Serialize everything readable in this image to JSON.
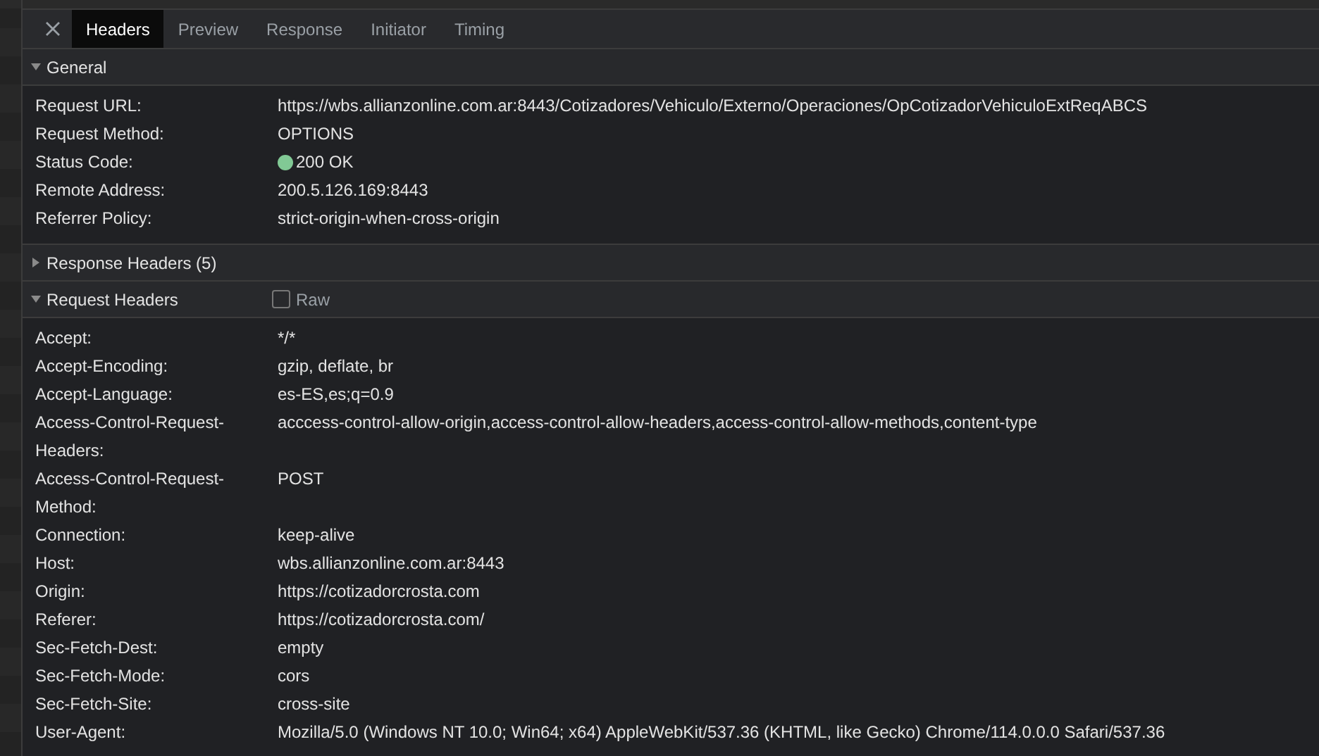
{
  "tabs": [
    {
      "label": "Headers",
      "selected": true
    },
    {
      "label": "Preview",
      "selected": false
    },
    {
      "label": "Response",
      "selected": false
    },
    {
      "label": "Initiator",
      "selected": false
    },
    {
      "label": "Timing",
      "selected": false
    }
  ],
  "sections": [
    {
      "title": "General",
      "expanded": true,
      "rows": [
        {
          "kind": "text",
          "name": "Request URL:",
          "value": "https://wbs.allianzonline.com.ar:8443/Cotizadores/Vehiculo/Externo/Operaciones/OpCotizadorVehiculoExtReqABCS"
        },
        {
          "kind": "text",
          "name": "Request Method:",
          "value": "OPTIONS"
        },
        {
          "kind": "status",
          "name": "Status Code:",
          "value": "200 OK",
          "color": "#81c995"
        },
        {
          "kind": "text",
          "name": "Remote Address:",
          "value": "200.5.126.169:8443"
        },
        {
          "kind": "text",
          "name": "Referrer Policy:",
          "value": "strict-origin-when-cross-origin"
        }
      ]
    },
    {
      "title": "Response Headers (5)",
      "expanded": false
    },
    {
      "title": "Request Headers",
      "expanded": true,
      "raw": {
        "label": "Raw",
        "checked": false
      },
      "rows": [
        {
          "kind": "text",
          "name": "Accept:",
          "value": "*/*"
        },
        {
          "kind": "text",
          "name": "Accept-Encoding:",
          "value": "gzip, deflate, br"
        },
        {
          "kind": "text",
          "name": "Accept-Language:",
          "value": "es-ES,es;q=0.9"
        },
        {
          "kind": "text",
          "name": "Access-Control-Request-Headers:",
          "value": "acccess-control-allow-origin,access-control-allow-headers,access-control-allow-methods,content-type"
        },
        {
          "kind": "text",
          "name": "Access-Control-Request-Method:",
          "value": "POST"
        },
        {
          "kind": "text",
          "name": "Connection:",
          "value": "keep-alive"
        },
        {
          "kind": "text",
          "name": "Host:",
          "value": "wbs.allianzonline.com.ar:8443"
        },
        {
          "kind": "text",
          "name": "Origin:",
          "value": "https://cotizadorcrosta.com"
        },
        {
          "kind": "text",
          "name": "Referer:",
          "value": "https://cotizadorcrosta.com/"
        },
        {
          "kind": "text",
          "name": "Sec-Fetch-Dest:",
          "value": "empty"
        },
        {
          "kind": "text",
          "name": "Sec-Fetch-Mode:",
          "value": "cors"
        },
        {
          "kind": "text",
          "name": "Sec-Fetch-Site:",
          "value": "cross-site"
        },
        {
          "kind": "text",
          "name": "User-Agent:",
          "value": "Mozilla/5.0 (Windows NT 10.0; Win64; x64) AppleWebKit/537.36 (KHTML, like Gecko) Chrome/114.0.0.0 Safari/537.36"
        }
      ]
    }
  ]
}
